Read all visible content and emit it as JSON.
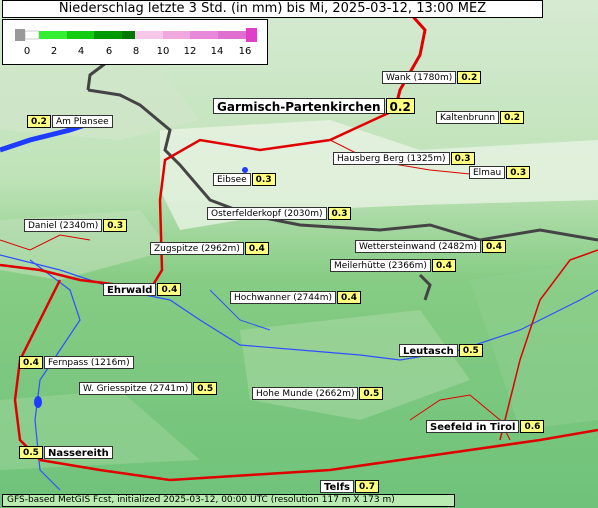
{
  "title": "Niederschlag letzte 3 Std. (in mm) bis Mi, 2025-03-12, 13:00 MEZ",
  "legend": {
    "ticks": [
      "0",
      "2",
      "4",
      "6",
      "8",
      "10",
      "12",
      "14",
      "16"
    ],
    "colors": [
      "#00cc00",
      "#22dd22",
      "#11bb11",
      "#009900",
      "#007700",
      "#f4b6e0",
      "#ee99dd",
      "#e880d6",
      "#e040c8"
    ]
  },
  "places": [
    {
      "name": "Wank (1780m)",
      "value": "0.2",
      "val_first": false,
      "style": "small"
    },
    {
      "name": "Garmisch-Partenkirchen",
      "value": "0.2",
      "val_first": false,
      "style": "big2"
    },
    {
      "name": "Am Plansee",
      "value": "0.2",
      "val_first": true,
      "style": "small"
    },
    {
      "name": "Kaltenbrunn",
      "value": "0.2",
      "val_first": false,
      "style": "small"
    },
    {
      "name": "Hausberg Berg (1325m)",
      "value": "0.3",
      "val_first": false,
      "style": "small"
    },
    {
      "name": "Eibsee",
      "value": "0.3",
      "val_first": false,
      "style": "small"
    },
    {
      "name": "Elmau",
      "value": "0.3",
      "val_first": false,
      "style": "small"
    },
    {
      "name": "Osterfelderkopf (2030m)",
      "value": "0.3",
      "val_first": false,
      "style": "small"
    },
    {
      "name": "Daniel (2340m)",
      "value": "0.3",
      "val_first": false,
      "style": "small"
    },
    {
      "name": "Zugspitze (2962m)",
      "value": "0.4",
      "val_first": false,
      "style": "small"
    },
    {
      "name": "Wettersteinwand (2482m)",
      "value": "0.4",
      "val_first": false,
      "style": "small"
    },
    {
      "name": "Meilerhütte (2366m)",
      "value": "0.4",
      "val_first": false,
      "style": "small"
    },
    {
      "name": "Ehrwald",
      "value": "0.4",
      "val_first": false,
      "style": "big"
    },
    {
      "name": "Hochwanner (2744m)",
      "value": "0.4",
      "val_first": false,
      "style": "small"
    },
    {
      "name": "Leutasch",
      "value": "0.5",
      "val_first": false,
      "style": "big"
    },
    {
      "name": "Fernpass (1216m)",
      "value": "0.4",
      "val_first": true,
      "style": "small"
    },
    {
      "name": "W. Griesspitze (2741m)",
      "value": "0.5",
      "val_first": false,
      "style": "small"
    },
    {
      "name": "Hohe Munde (2662m)",
      "value": "0.5",
      "val_first": false,
      "style": "small"
    },
    {
      "name": "Seefeld in Tirol",
      "value": "0.6",
      "val_first": false,
      "style": "big"
    },
    {
      "name": "Nassereith",
      "value": "0.5",
      "val_first": true,
      "style": "big"
    },
    {
      "name": "Telfs",
      "value": "0.7",
      "val_first": false,
      "style": "big"
    }
  ],
  "footer": "GFS-based MetGIS Fcst, initialized 2025-03-12, 00:00 UTC  (resolution 117 m X 173 m)"
}
